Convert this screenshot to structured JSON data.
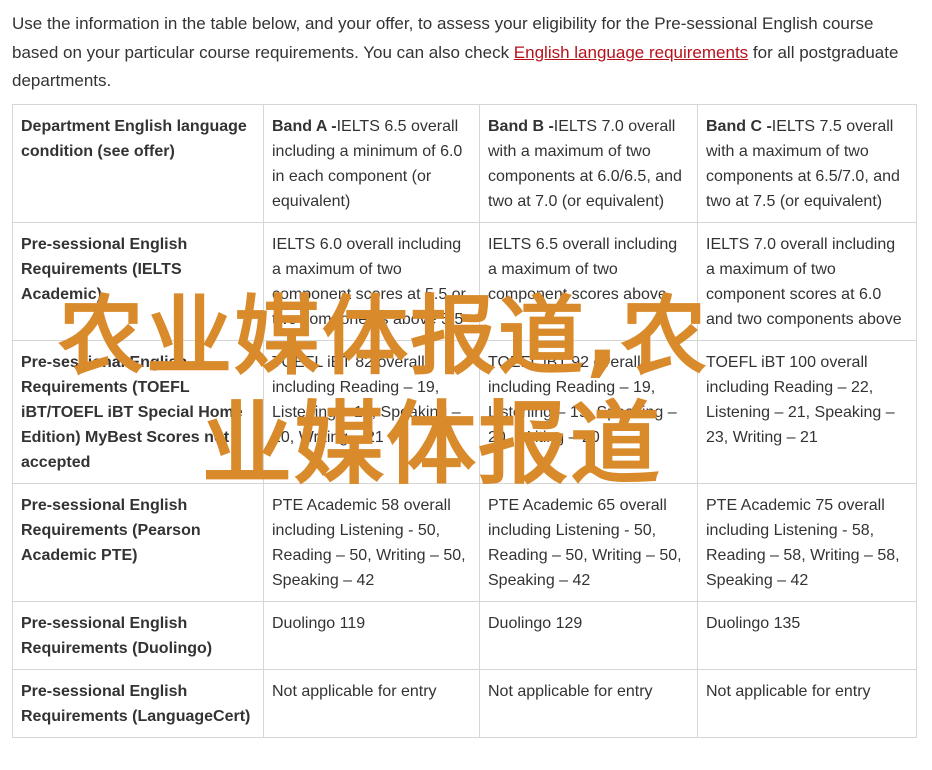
{
  "intro": {
    "text_before": "Use the information in the table below, and your offer, to assess your eligibility for the Pre-sessional English course based on your particular course requirements. You can also check ",
    "link": "English language requirements",
    "text_after": " for all postgraduate departments."
  },
  "table": {
    "header": {
      "first": "Department English language condition (see offer)",
      "bands": [
        {
          "name": "Band A -",
          "text": "IELTS 6.5 overall including a minimum of 6.0 in each component (or equivalent)"
        },
        {
          "name": "Band B -",
          "text": "IELTS 7.0 overall with a maximum of two components at 6.0/6.5, and two at 7.0 (or equivalent)"
        },
        {
          "name": "Band C -",
          "text": "IELTS 7.5 overall with a maximum of two components at 6.5/7.0, and two at 7.5 (or equivalent)"
        }
      ]
    },
    "rows": [
      {
        "label": "Pre-sessional English Requirements (IELTS Academic)",
        "cells": [
          "IELTS 6.0 overall including a maximum of two component scores at 5.5 or two components above 5.5",
          "IELTS 6.5 overall including a maximum of two component scores above",
          "IELTS 7.0 overall including a maximum of two component scores at 6.0 and two components above"
        ]
      },
      {
        "label": "Pre-sessional English Requirements (TOEFL iBT/TOEFL iBT Special Home Edition) MyBest Scores not accepted",
        "cells": [
          "TOEFL iBT 82 overall including Reading – 19, Listening – 19, Speaking – 20, Writing – 21",
          "TOEFL iBT 92 overall including Reading – 19, Listening – 19, Speaking – 20, Writing – 20",
          "TOEFL iBT 100 overall including Reading – 22, Listening – 21, Speaking – 23, Writing – 21"
        ]
      },
      {
        "label": "Pre-sessional English Requirements (Pearson Academic PTE)",
        "cells": [
          "PTE Academic 58 overall including Listening - 50, Reading – 50, Writing – 50, Speaking – 42",
          "PTE Academic 65 overall including Listening - 50, Reading – 50, Writing – 50, Speaking – 42",
          "PTE Academic 75 overall including Listening - 58, Reading – 58, Writing – 58, Speaking – 42"
        ]
      },
      {
        "label": "Pre-sessional English Requirements (Duolingo)",
        "cells": [
          "Duolingo 119",
          "Duolingo 129",
          "Duolingo 135"
        ]
      },
      {
        "label": "Pre-sessional English Requirements (LanguageCert)",
        "cells": [
          "Not applicable for entry",
          "Not applicable for entry",
          "Not applicable for entry"
        ]
      }
    ]
  },
  "watermark": {
    "line1": "农业媒体报道,农",
    "line2": "业媒体报道",
    "color": "#d98a2b"
  }
}
